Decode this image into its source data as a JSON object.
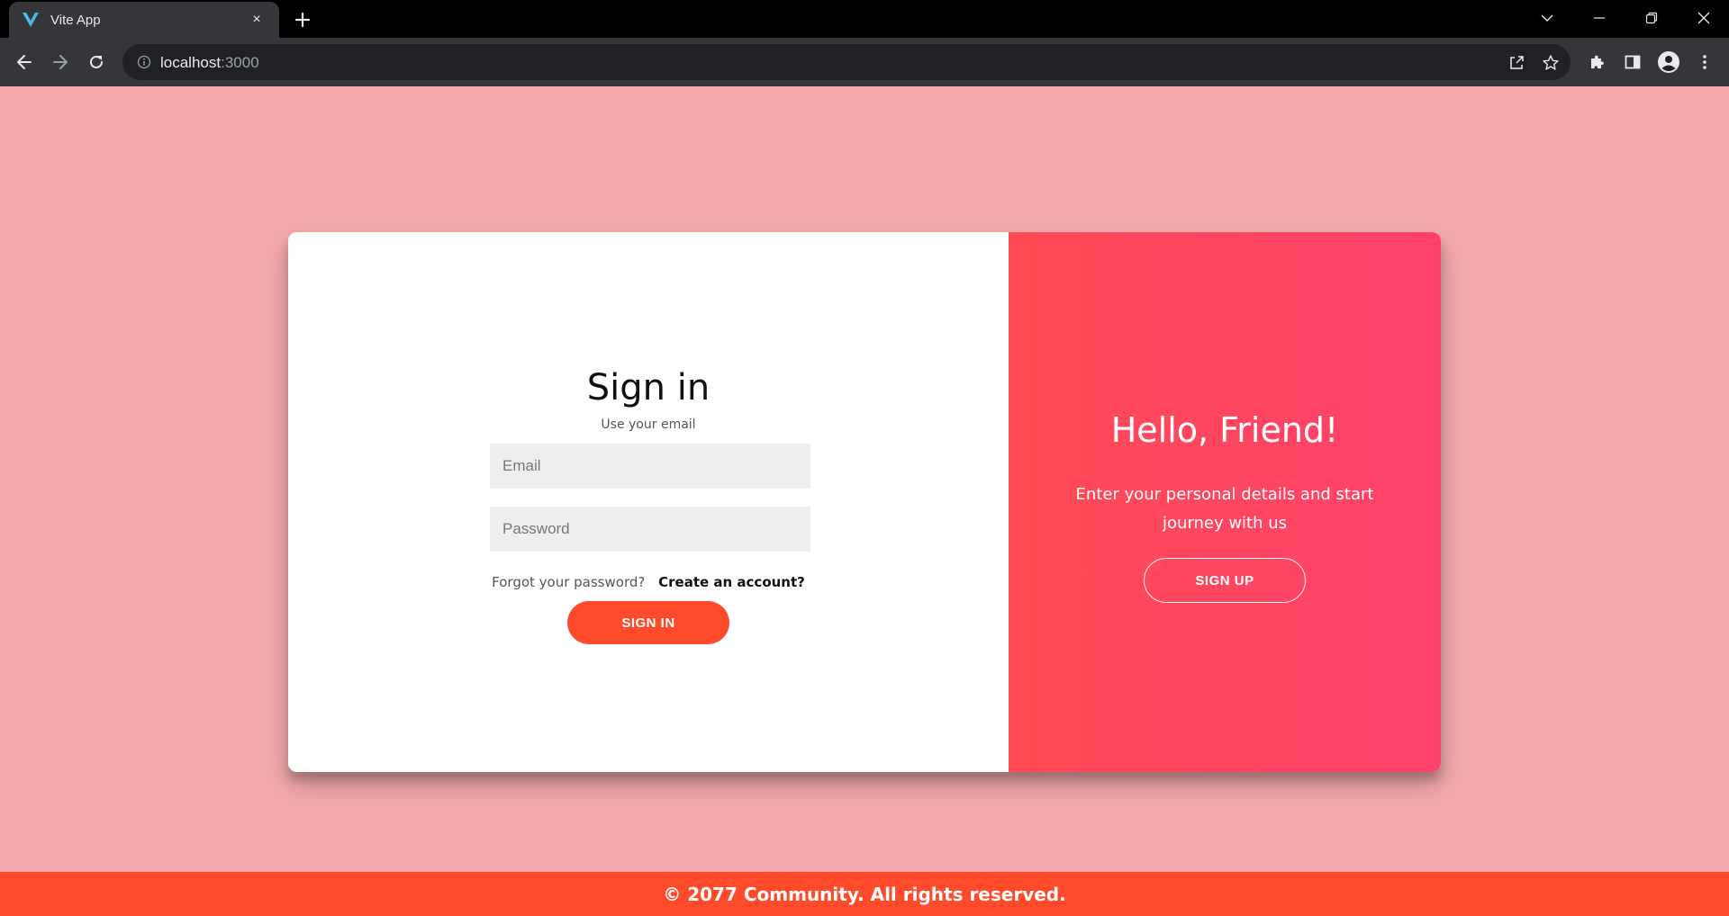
{
  "browser": {
    "tab_title": "Vite App",
    "tab_favicon": "vite-logo-icon",
    "tab_close": "×",
    "new_tab": "new-tab-plus-icon",
    "url_host": "localhost",
    "url_port": ":3000",
    "icons": {
      "back": "arrow-left-icon",
      "forward": "arrow-right-icon",
      "reload": "reload-icon",
      "info": "info-icon",
      "share": "share-icon",
      "bookmark": "star-icon",
      "extensions": "puzzle-icon",
      "side_panel": "side-panel-icon",
      "profile": "profile-icon",
      "menu": "kebab-menu-icon",
      "tab_search": "chevron-down-icon",
      "minimize": "minimize-icon",
      "restore": "restore-icon",
      "close": "close-icon"
    }
  },
  "signin": {
    "title": "Sign in",
    "subtitle": "Use your email",
    "email_placeholder": "Email",
    "password_placeholder": "Password",
    "forgot_label": "Forgot your password?",
    "create_label": "Create an account?",
    "button_label": "Sign In"
  },
  "overlay": {
    "title": "Hello, Friend!",
    "text": "Enter your personal details and start journey with us",
    "button_label": "Sign Up"
  },
  "footer": {
    "text": "© 2077 Community. All rights reserved."
  },
  "colors": {
    "page_bg": "#f3a9ab",
    "accent": "#ff4b2b",
    "overlay_start": "#ff4b55",
    "overlay_end": "#ff416c"
  }
}
